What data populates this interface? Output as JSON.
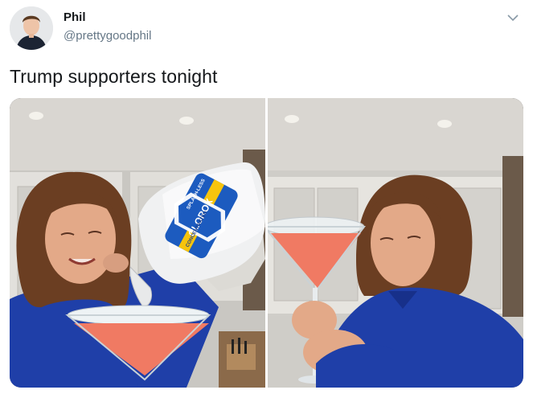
{
  "tweet": {
    "author_name": "Phil",
    "author_handle": "@prettygoodphil",
    "text": "Trump supporters tonight"
  },
  "media": {
    "bottle_label": "CLOROX",
    "bottle_band_text": "CONCENTRATED",
    "bottle_top_text": "SPLASH-LESS"
  },
  "colors": {
    "name": "#14171a",
    "handle": "#657786",
    "shirt": "#1f3fa8",
    "drink": "#f07a63",
    "clorox_blue": "#1c5bbf"
  }
}
